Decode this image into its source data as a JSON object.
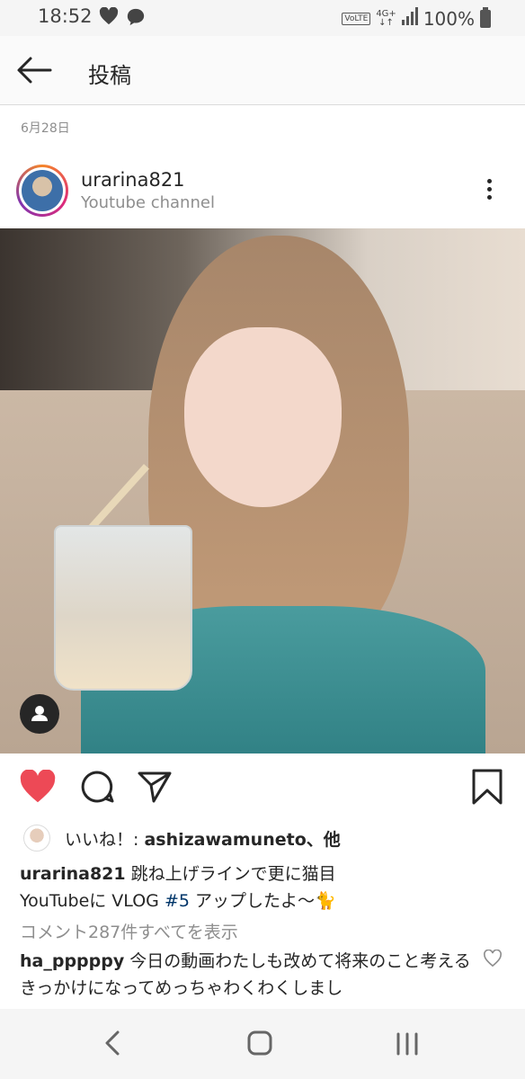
{
  "status_bar": {
    "time": "18:52",
    "left_icons": [
      "heart-icon",
      "chat-bubble-icon"
    ],
    "volte": "VoLTE",
    "network_top": "4G+",
    "network_bottom": "↓↑",
    "battery_text": "100%"
  },
  "header": {
    "title": "投稿"
  },
  "post": {
    "date": "6月28日",
    "username": "urarina821",
    "location": "Youtube channel",
    "likes": {
      "prefix": "いいね！: ",
      "user": "ashizawamuneto",
      "suffix": "、他"
    },
    "caption": {
      "username": "urarina821",
      "line1": " 跳ね上げラインで更に猫目",
      "line2_before": "YouTubeに VLOG ",
      "hashtag": "#5",
      "line2_after": " アップしたよ〜🐈"
    },
    "view_comments": "コメント287件すべてを表示",
    "comment": {
      "username": "ha_pppppy",
      "text": " 今日の動画わたしも改めて将来のこと考えるきっかけになってめっちゃわくわくしまし"
    }
  },
  "colors": {
    "like_red": "#ed4956",
    "text": "#262626",
    "muted": "#8e8e8e",
    "hashtag": "#003569"
  }
}
